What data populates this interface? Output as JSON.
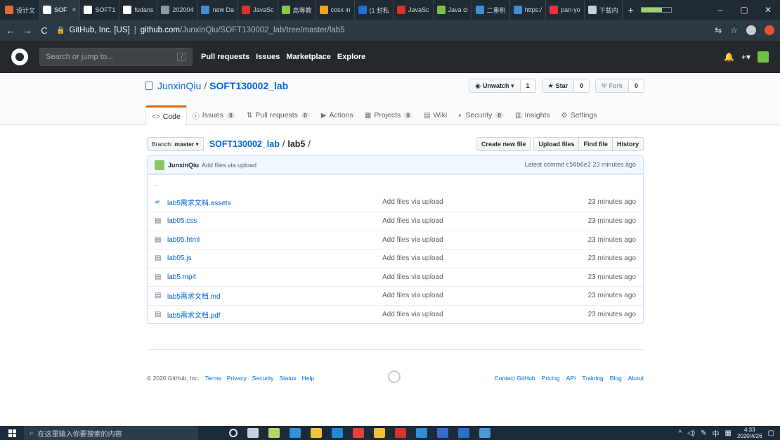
{
  "browser": {
    "tabs": [
      {
        "label": "设计文",
        "color": "#e06c3c"
      },
      {
        "label": "SOF",
        "color": "#ffffff",
        "active": true
      },
      {
        "label": "SOFT1",
        "color": "#ffffff"
      },
      {
        "label": "fudans",
        "color": "#ffffff"
      },
      {
        "label": "202004",
        "color": "#8a9aa5"
      },
      {
        "label": "new Da",
        "color": "#3d8fd6"
      },
      {
        "label": "JavaSc",
        "color": "#d9342b"
      },
      {
        "label": "高等教",
        "color": "#8cc63f"
      },
      {
        "label": "cosx in",
        "color": "#f0a31a"
      },
      {
        "label": "(1 封私",
        "color": "#1f6fd6"
      },
      {
        "label": "JavaSc",
        "color": "#d9342b"
      },
      {
        "label": "Java cl",
        "color": "#7cc04b"
      },
      {
        "label": "二重积",
        "color": "#3d8fd6"
      },
      {
        "label": "https:/",
        "color": "#3d8fd6"
      },
      {
        "label": "pan-yo",
        "color": "#e8323c"
      },
      {
        "label": "下载内",
        "color": "#c6d0d8"
      }
    ],
    "url_org": "GitHub, Inc. [US]",
    "url_host": "github.com",
    "url_path": "/JunxinQiu/SOFT130002_lab/tree/master/lab5"
  },
  "gh": {
    "search_placeholder": "Search or jump to...",
    "slash": "/",
    "nav": [
      "Pull requests",
      "Issues",
      "Marketplace",
      "Explore"
    ]
  },
  "repo": {
    "owner": "JunxinQiu",
    "sep": "/",
    "name": "SOFT130002_lab",
    "watch_label": "Unwatch ▾",
    "watch_count": "1",
    "star_label": "Star",
    "star_count": "0",
    "fork_label": "Fork",
    "fork_count": "0",
    "tabs": [
      {
        "icon": "<>",
        "label": "Code",
        "count": ""
      },
      {
        "icon": "ⓘ",
        "label": "Issues",
        "count": "0"
      },
      {
        "icon": "⇅",
        "label": "Pull requests",
        "count": "0"
      },
      {
        "icon": "▶",
        "label": "Actions",
        "count": ""
      },
      {
        "icon": "▦",
        "label": "Projects",
        "count": "0"
      },
      {
        "icon": "▤",
        "label": "Wiki",
        "count": ""
      },
      {
        "icon": "◐",
        "label": "Security",
        "count": "0"
      },
      {
        "icon": "▥",
        "label": "Insights",
        "count": ""
      },
      {
        "icon": "⚙",
        "label": "Settings",
        "count": ""
      }
    ]
  },
  "filenav": {
    "branch_prefix": "Branch:",
    "branch": "master ▾",
    "crumb_repo": "SOFT130002_lab",
    "crumb_sep": "/",
    "crumb_dir": "lab5",
    "crumb_end": "/",
    "buttons": [
      "Create new file",
      "Upload files",
      "Find file",
      "History"
    ]
  },
  "commit": {
    "author": "JunxinQiu",
    "message": "Add files via upload",
    "latest_label": "Latest commit",
    "sha": "c50b6e2",
    "age": "23 minutes ago"
  },
  "files": {
    "up": "..",
    "rows": [
      {
        "name": "lab5需求文档.assets",
        "type": "dir",
        "msg": "Add files via upload",
        "age": "23 minutes ago"
      },
      {
        "name": "lab05.css",
        "type": "file",
        "msg": "Add files via upload",
        "age": "23 minutes ago"
      },
      {
        "name": "lab05.html",
        "type": "file",
        "msg": "Add files via upload",
        "age": "23 minutes ago"
      },
      {
        "name": "lab05.js",
        "type": "file",
        "msg": "Add files via upload",
        "age": "23 minutes ago"
      },
      {
        "name": "lab5.mp4",
        "type": "file",
        "msg": "Add files via upload",
        "age": "23 minutes ago"
      },
      {
        "name": "lab5需求文档.md",
        "type": "file",
        "msg": "Add files via upload",
        "age": "23 minutes ago"
      },
      {
        "name": "lab5需求文档.pdf",
        "type": "file",
        "msg": "Add files via upload",
        "age": "23 minutes ago"
      }
    ]
  },
  "footer": {
    "copyright": "© 2020 GitHub, Inc.",
    "left_links": [
      "Terms",
      "Privacy",
      "Security",
      "Status",
      "Help"
    ],
    "right_links": [
      "Contact GitHub",
      "Pricing",
      "API",
      "Training",
      "Blog",
      "About"
    ]
  },
  "taskbar": {
    "search_placeholder": "在这里输入你要搜索的内容",
    "ime": "中",
    "time": "4:33",
    "date": "2020/4/26",
    "apps": [
      "#e8e8e8",
      "#c8d2dc",
      "#b9d36a",
      "#2f8fd8",
      "#f3c436",
      "#1f8ad8",
      "#e8423a",
      "#f0c030",
      "#d9342b",
      "#2f8fd8",
      "#3a6ac8",
      "#2d6fc8",
      "#4a9ad8"
    ]
  }
}
